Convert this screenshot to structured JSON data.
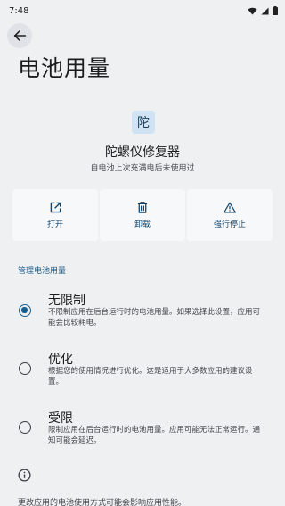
{
  "status_bar": {
    "time": "7:48"
  },
  "header": {
    "title": "电池用量"
  },
  "app": {
    "icon_char": "陀",
    "name": "陀螺仪修复器",
    "subtitle": "自电池上次充满电后未使用过"
  },
  "actions": [
    {
      "label": "打开",
      "icon": "open-external-icon"
    },
    {
      "label": "卸载",
      "icon": "trash-icon"
    },
    {
      "label": "强行停止",
      "icon": "warning-icon"
    }
  ],
  "section": {
    "title": "管理电池用量"
  },
  "options": [
    {
      "title": "无限制",
      "desc": "不限制应用在后台运行时的电池用量。如果选择此设置，应用可能会比较耗电。",
      "checked": true
    },
    {
      "title": "优化",
      "desc": "根据您的使用情况进行优化。这是适用于大多数应用的建议设置。",
      "checked": false
    },
    {
      "title": "受限",
      "desc": "限制应用在后台运行时的电池用量。应用可能无法正常运行。通知可能会延迟。",
      "checked": false
    }
  ],
  "footer": {
    "text": "更改应用的电池使用方式可能会影响应用性能。"
  },
  "colors": {
    "accent": "#1a5f8f",
    "background": "#eef0f2"
  }
}
